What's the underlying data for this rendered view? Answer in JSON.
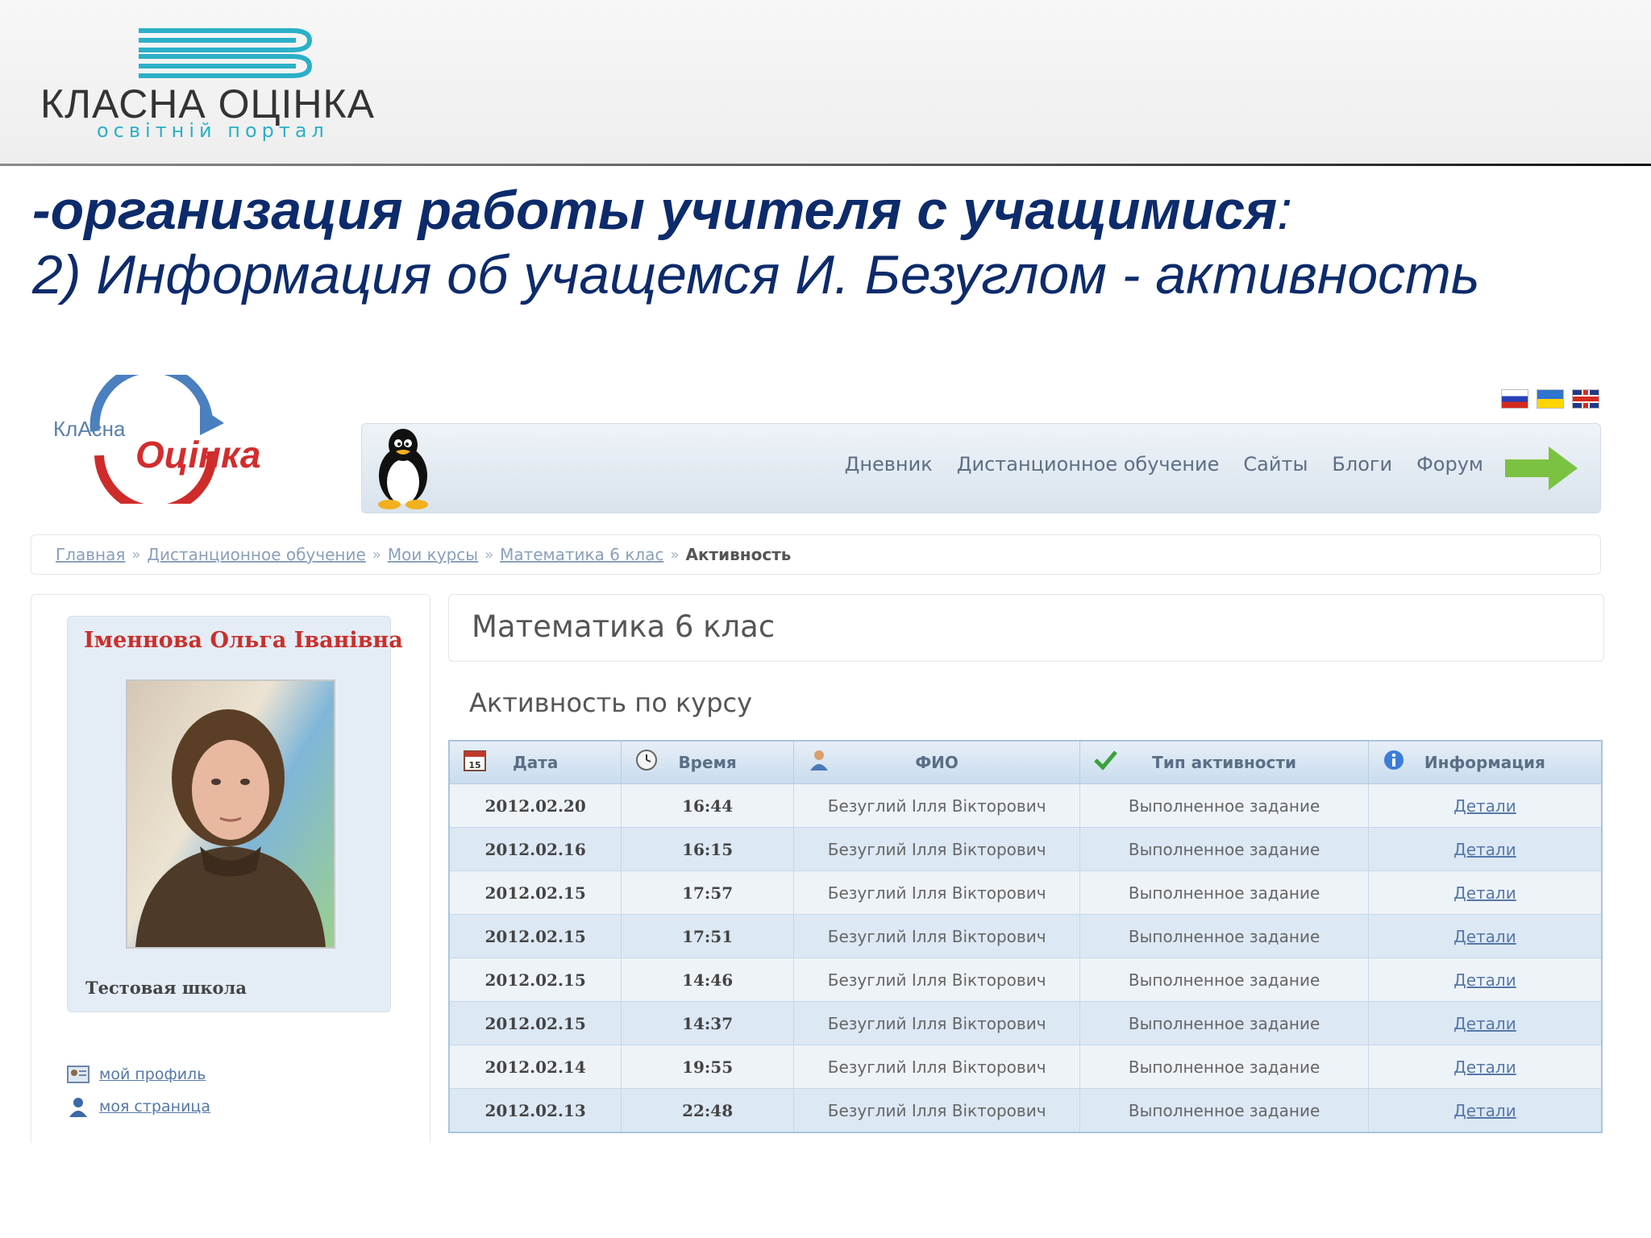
{
  "slide": {
    "brand_name": "КЛАСНА ОЦІНКА",
    "brand_tagline": "освітній портал",
    "title_prefix": "-",
    "title_main": "организация работы учителя с учащимися",
    "title_suffix": ":",
    "subtitle": "2) Информация об учащемся И. Безуглом - активность"
  },
  "site": {
    "logo_part1": "КлАсна",
    "logo_part2": "Оцінка",
    "nav": {
      "items": [
        "Дневник",
        "Дистанционное обучение",
        "Сайты",
        "Блоги",
        "Форум"
      ]
    },
    "breadcrumb": {
      "links": [
        "Главная",
        "Дистанционное обучение",
        "Мои курсы",
        "Математика 6 клас"
      ],
      "separator": "»",
      "current": "Активность"
    },
    "sidebar": {
      "teacher_name": "Іменнова Ольга Іванівна",
      "school": "Тестовая школа",
      "links": [
        "мой профиль",
        "моя страница"
      ]
    },
    "course_title": "Математика 6 клас",
    "activity_heading": "Активность по курсу",
    "table": {
      "headers": [
        "Дата",
        "Время",
        "ФИО",
        "Тип активности",
        "Информация"
      ],
      "header_icons": [
        "calendar-icon",
        "clock-icon",
        "user-icon",
        "check-icon",
        "info-icon"
      ],
      "rows": [
        {
          "date": "2012.02.20",
          "time": "16:44",
          "name": "Безуглий Ілля Вікторович",
          "type": "Выполненное задание",
          "info": "Детали"
        },
        {
          "date": "2012.02.16",
          "time": "16:15",
          "name": "Безуглий Ілля Вікторович",
          "type": "Выполненное задание",
          "info": "Детали"
        },
        {
          "date": "2012.02.15",
          "time": "17:57",
          "name": "Безуглий Ілля Вікторович",
          "type": "Выполненное задание",
          "info": "Детали"
        },
        {
          "date": "2012.02.15",
          "time": "17:51",
          "name": "Безуглий Ілля Вікторович",
          "type": "Выполненное задание",
          "info": "Детали"
        },
        {
          "date": "2012.02.15",
          "time": "14:46",
          "name": "Безуглий Ілля Вікторович",
          "type": "Выполненное задание",
          "info": "Детали"
        },
        {
          "date": "2012.02.15",
          "time": "14:37",
          "name": "Безуглий Ілля Вікторович",
          "type": "Выполненное задание",
          "info": "Детали"
        },
        {
          "date": "2012.02.14",
          "time": "19:55",
          "name": "Безуглий Ілля Вікторович",
          "type": "Выполненное задание",
          "info": "Детали"
        },
        {
          "date": "2012.02.13",
          "time": "22:48",
          "name": "Безуглий Ілля Вікторович",
          "type": "Выполненное задание",
          "info": "Детали"
        }
      ]
    }
  },
  "colors": {
    "title": "#0d2b6b",
    "brand_accent": "#2bb0c7",
    "teacher_name": "#c9302c",
    "link": "#5678a8"
  }
}
